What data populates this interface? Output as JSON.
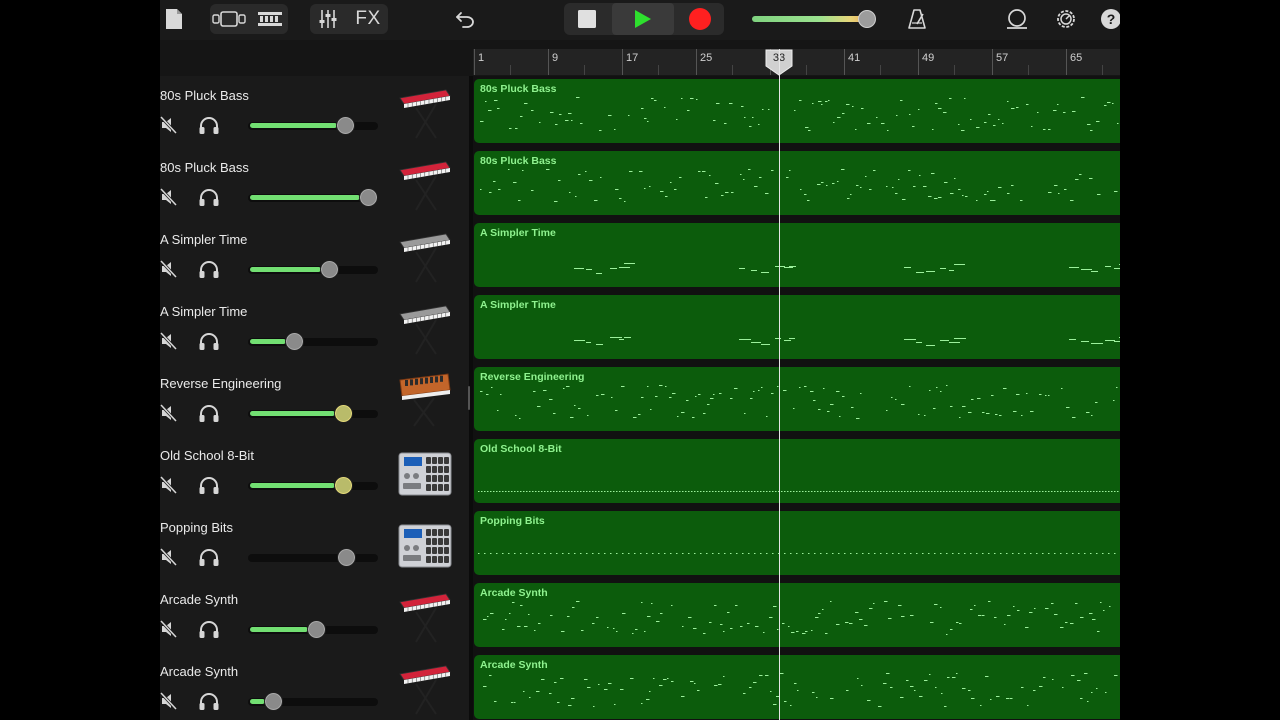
{
  "toolbar": {
    "fx_label": "FX",
    "icons": [
      "document-icon",
      "track-view-icon",
      "live-loops-icon",
      "mixer-icon",
      "undo-icon",
      "stop-icon",
      "play-icon",
      "record-icon",
      "metronome-icon",
      "loop-icon",
      "settings-icon",
      "help-icon"
    ],
    "master_volume": 0.87,
    "accent_play": "#2ee02e",
    "accent_record": "#ff2020"
  },
  "ruler": {
    "bars": [
      "1",
      "9",
      "17",
      "25",
      "33",
      "41",
      "49",
      "57",
      "65"
    ],
    "playhead_bar": "33"
  },
  "tracks": [
    {
      "name": "80s Pluck Bass",
      "volume": 0.75,
      "instrument": "keyboard-red"
    },
    {
      "name": "80s Pluck Bass",
      "volume": 0.94,
      "instrument": "keyboard-red"
    },
    {
      "name": "A Simpler Time",
      "volume": 0.63,
      "instrument": "keyboard-gray"
    },
    {
      "name": "A Simpler Time",
      "volume": 0.35,
      "instrument": "keyboard-gray"
    },
    {
      "name": "Reverse Engineering",
      "volume": 0.74,
      "instrument": "synth-orange"
    },
    {
      "name": "Old School 8-Bit",
      "volume": 0.74,
      "instrument": "drum-machine"
    },
    {
      "name": "Popping Bits",
      "volume": 0.76,
      "instrument": "drum-machine"
    },
    {
      "name": "Arcade Synth",
      "volume": 0.52,
      "instrument": "keyboard-red"
    },
    {
      "name": "Arcade Synth",
      "volume": 0.18,
      "instrument": "keyboard-red"
    }
  ],
  "regions": [
    {
      "label": "80s Pluck Bass"
    },
    {
      "label": "80s Pluck Bass"
    },
    {
      "label": "A Simpler Time"
    },
    {
      "label": "A Simpler Time"
    },
    {
      "label": "Reverse Engineering"
    },
    {
      "label": "Old School 8-Bit"
    },
    {
      "label": "Popping Bits"
    },
    {
      "label": "Arcade Synth"
    },
    {
      "label": "Arcade Synth"
    }
  ],
  "colors": {
    "region_fill": "#0c5c0c",
    "region_label": "#8ff28f",
    "volume_fill": "#72df72"
  }
}
